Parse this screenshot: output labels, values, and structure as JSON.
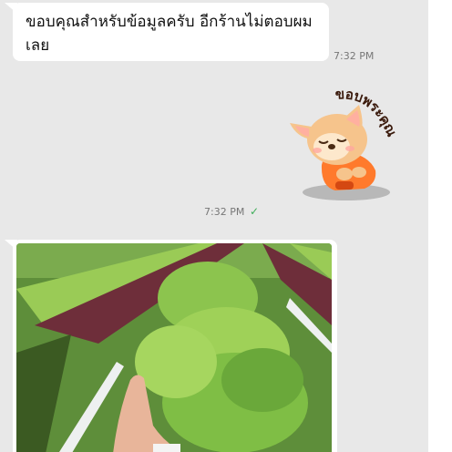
{
  "messages": [
    {
      "text": "ขอบคุณสำหรับข้อมูลครับ อีกร้านไม่ตอบผมเลย",
      "time": "7:32 PM"
    },
    {
      "sticker_text": "ขอบพระคุณ",
      "time": "7:32 PM",
      "status_icon": "check-icon"
    }
  ],
  "colors": {
    "chat_bg": "#e8e8e8",
    "bubble": "#ffffff",
    "check": "#3fae5a"
  }
}
